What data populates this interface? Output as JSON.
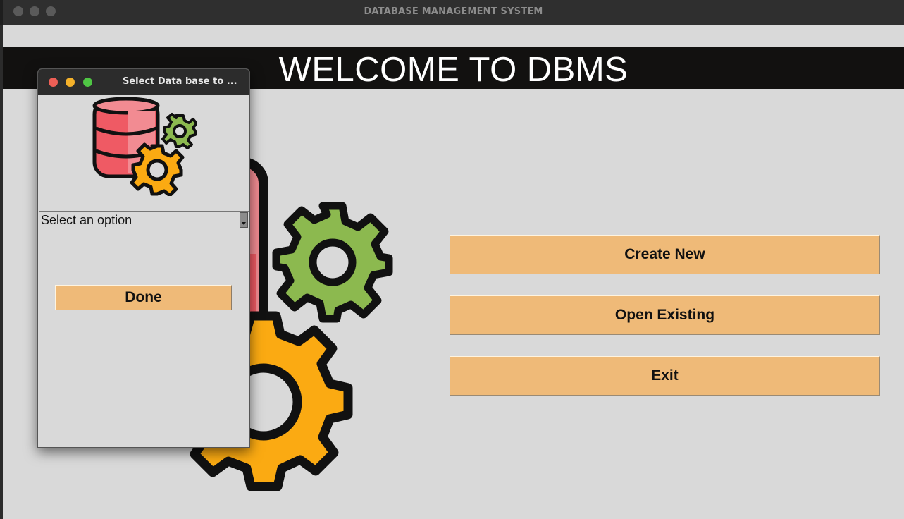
{
  "main_window": {
    "title": "DATABASE MANAGEMENT SYSTEM",
    "banner_text": "WELCOME TO DBMS",
    "buttons": [
      {
        "label": "Create New"
      },
      {
        "label": "Open Existing"
      },
      {
        "label": "Exit"
      }
    ],
    "illustration_icon": "database-gears-icon"
  },
  "dialog": {
    "title": "Select Data base to ...",
    "illustration_icon": "database-gears-icon",
    "select": {
      "value": "Select an option"
    },
    "done_label": "Done"
  },
  "colors": {
    "button_fill": "#efba78",
    "banner_bg": "#121110",
    "window_bg": "#d9d9d9",
    "db_red": "#ef5a64",
    "gear_green": "#8cb94f",
    "gear_orange": "#fbaa12"
  }
}
